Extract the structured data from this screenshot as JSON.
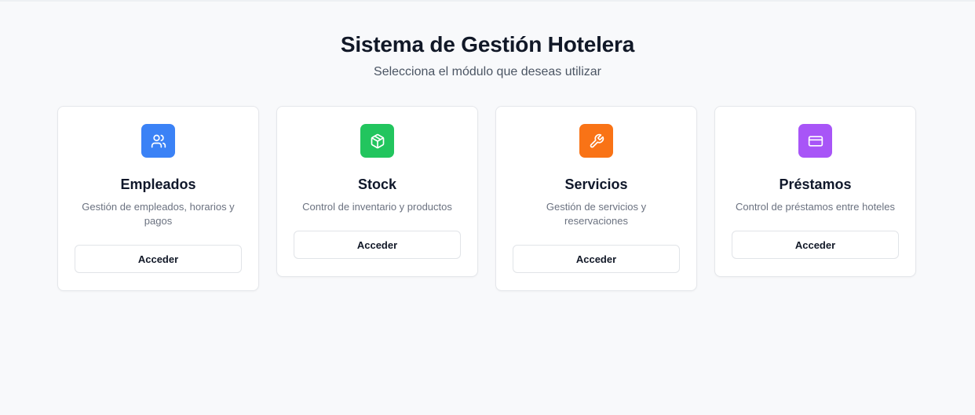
{
  "header": {
    "title": "Sistema de Gestión Hotelera",
    "subtitle": "Selecciona el módulo que deseas utilizar"
  },
  "modules": [
    {
      "title": "Empleados",
      "description": "Gestión de empleados, horarios y pagos",
      "button_label": "Acceder",
      "icon": "users-icon",
      "color": "#3b82f6"
    },
    {
      "title": "Stock",
      "description": "Control de inventario y productos",
      "button_label": "Acceder",
      "icon": "package-icon",
      "color": "#22c55e"
    },
    {
      "title": "Servicios",
      "description": "Gestión de servicios y reservaciones",
      "button_label": "Acceder",
      "icon": "wrench-icon",
      "color": "#f97316"
    },
    {
      "title": "Préstamos",
      "description": "Control de préstamos entre hoteles",
      "button_label": "Acceder",
      "icon": "credit-card-icon",
      "color": "#a855f7"
    }
  ]
}
